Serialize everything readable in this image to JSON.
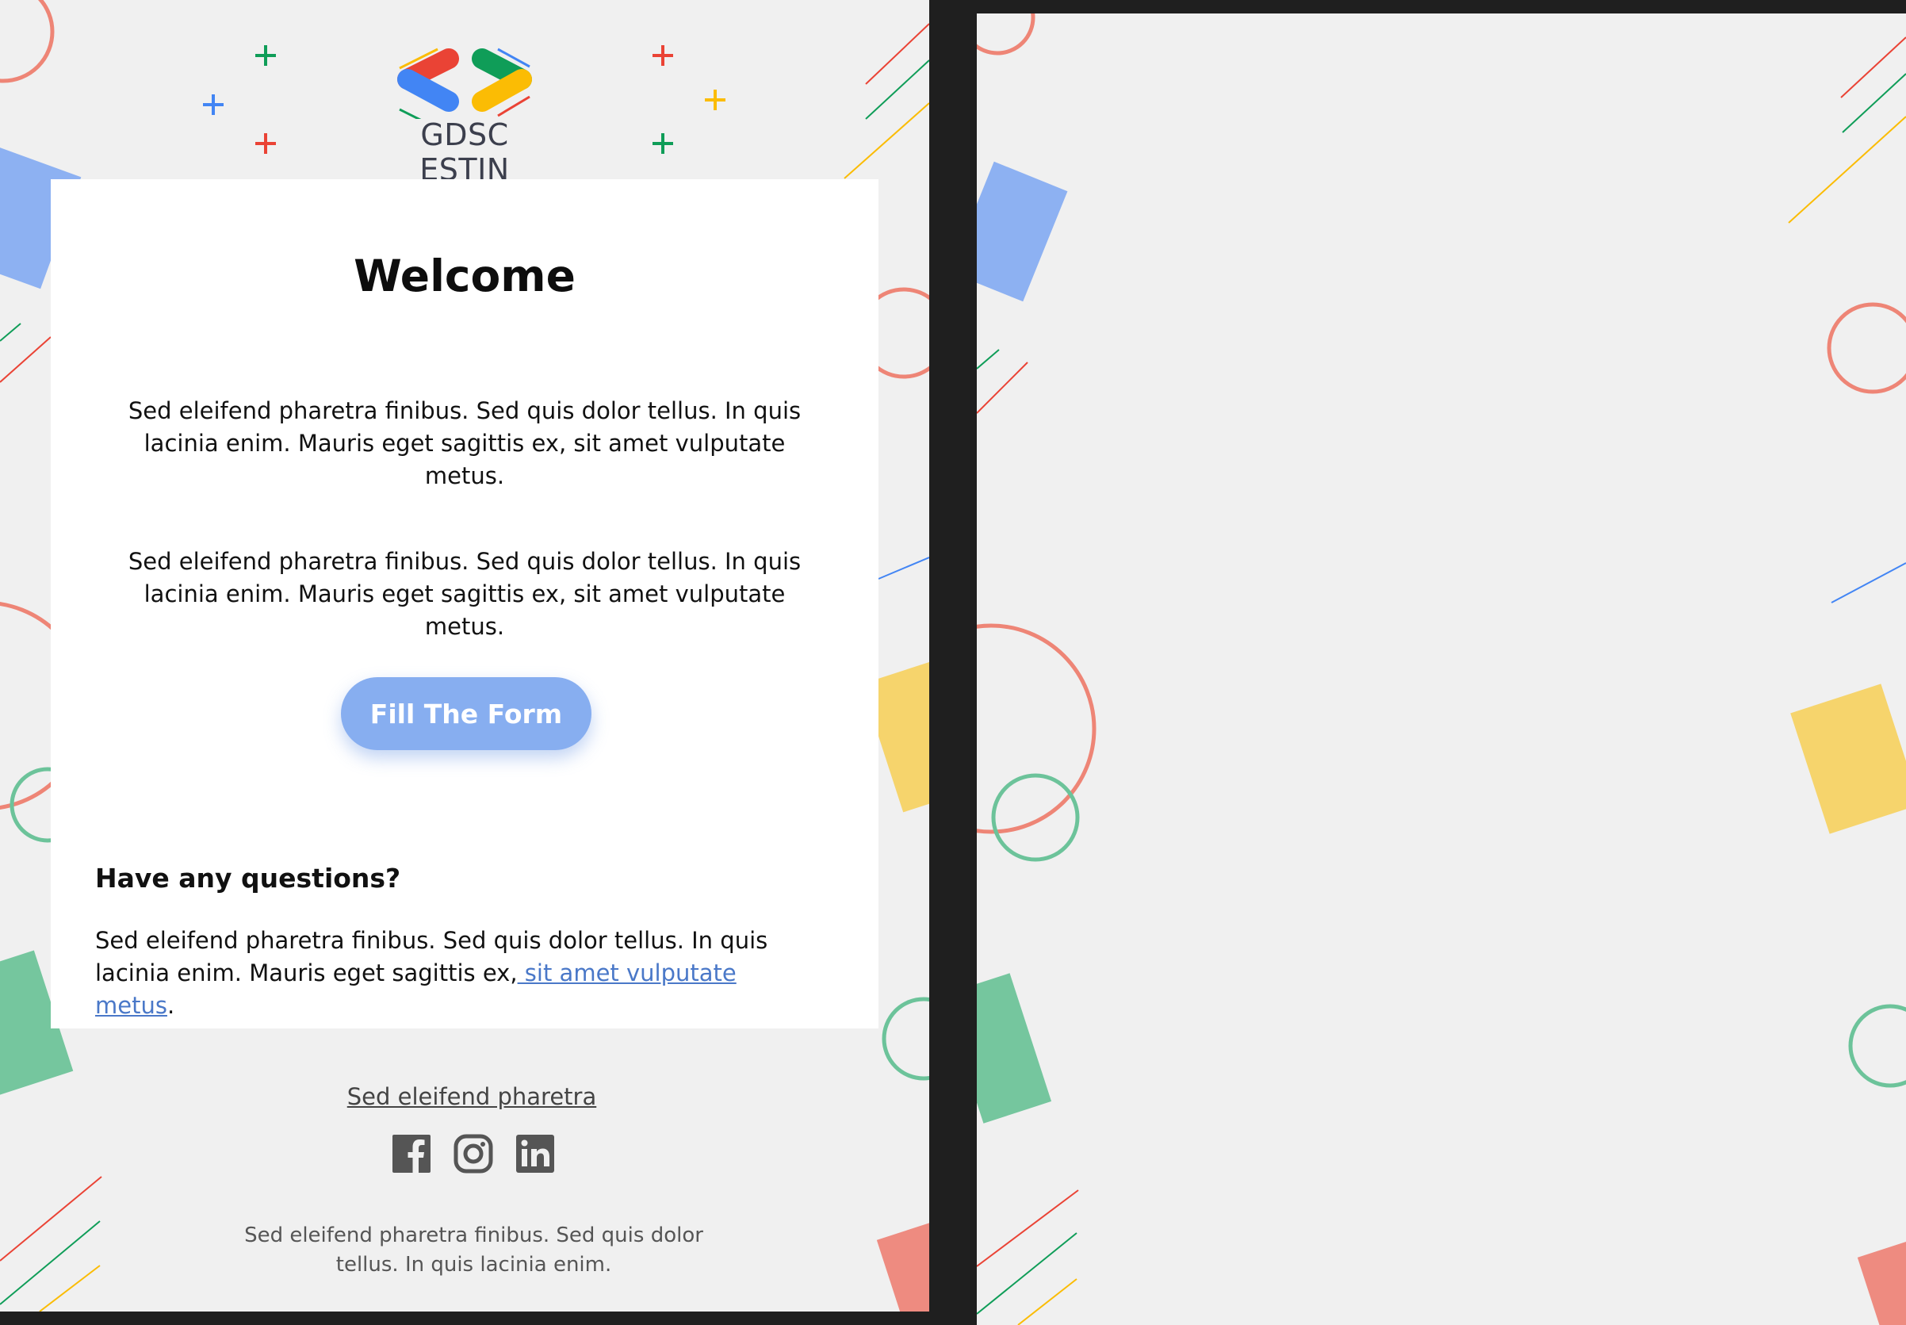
{
  "brand": {
    "name": "GDSC ESTIN"
  },
  "email": {
    "title": "Welcome",
    "paragraph_1": "Sed eleifend pharetra finibus. Sed quis dolor tellus. In quis lacinia enim. Mauris eget sagittis ex, sit amet vulputate metus.",
    "paragraph_2": "Sed eleifend pharetra finibus. Sed quis dolor tellus. In quis lacinia enim. Mauris eget sagittis ex, sit amet vulputate metus.",
    "cta_label": "Fill The Form",
    "questions_heading": "Have any questions?",
    "questions_text": "Sed eleifend pharetra finibus. Sed quis dolor tellus. In quis lacinia enim. Mauris eget sagittis ex,",
    "questions_link": " sit amet vulputate metus",
    "questions_end": "."
  },
  "footer": {
    "link": "Sed eleifend pharetra",
    "socials": [
      "facebook-icon",
      "instagram-icon",
      "linkedin-icon"
    ],
    "note": "Sed eleifend pharetra finibus. Sed quis dolor tellus. In quis lacinia enim."
  },
  "colors": {
    "red": "#ea4335",
    "green": "#0f9d58",
    "blue": "#4285f4",
    "yellow": "#fbbc04",
    "cta": "#87aef0",
    "background": "#f0f0f0",
    "frame": "#1f1f1f"
  }
}
